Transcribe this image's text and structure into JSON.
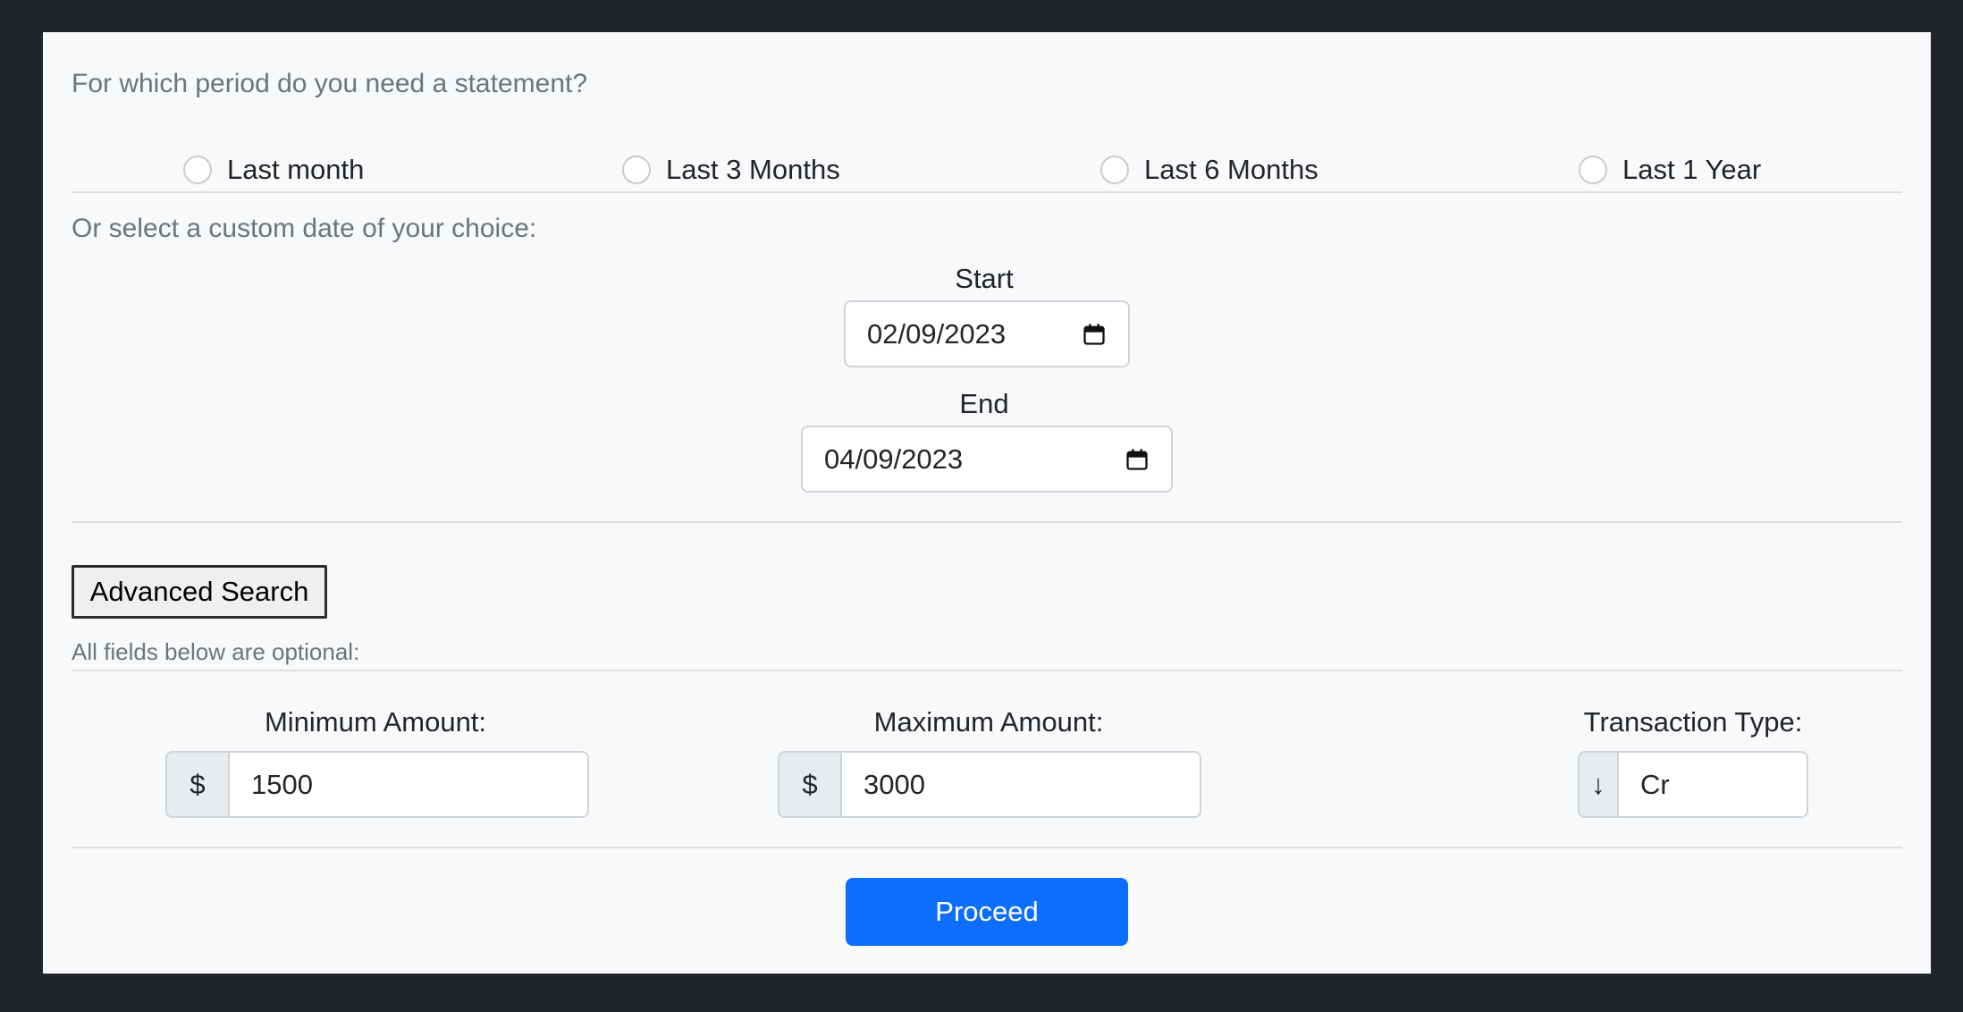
{
  "period": {
    "question": "For which period do you need a statement?",
    "options": [
      "Last month",
      "Last 3 Months",
      "Last 6 Months",
      "Last 1 Year"
    ]
  },
  "custom": {
    "label": "Or select a custom date of your choice:",
    "start_label": "Start",
    "start_value": "02/09/2023",
    "end_label": "End",
    "end_value": "04/09/2023",
    "calendar_icon": "calendar-icon"
  },
  "advanced": {
    "button_label": "Advanced Search",
    "optional_note": "All fields below are optional:",
    "min_label": "Minimum Amount:",
    "min_prefix": "$",
    "min_value": "1500",
    "max_label": "Maximum Amount:",
    "max_prefix": "$",
    "max_value": "3000",
    "type_label": "Transaction Type:",
    "type_prefix": "↓",
    "type_value": "Cr"
  },
  "proceed_label": "Proceed",
  "colors": {
    "page_background": "#212529",
    "card_background": "#f8f9fa",
    "primary": "#0d6efd",
    "muted_text": "#6c757d"
  }
}
